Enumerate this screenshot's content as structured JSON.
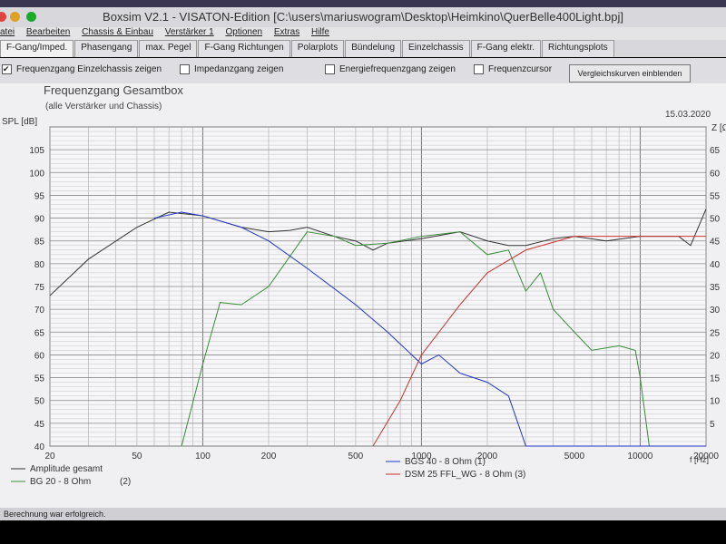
{
  "window": {
    "title": "Boxsim V2.1 - VISATON-Edition [C:\\users\\mariuswogram\\Desktop\\Heimkino\\QuerBelle400Light.bpj]"
  },
  "menu": [
    "atei",
    "Bearbeiten",
    "Chassis & Einbau",
    "Verstärker 1",
    "Optionen",
    "Extras",
    "Hilfe"
  ],
  "tabs": [
    "F-Gang/Imped.",
    "Phasengang",
    "max. Pegel",
    "F-Gang Richtungen",
    "Polarplots",
    "Bündelung",
    "Einzelchassis",
    "F-Gang elektr.",
    "Richtungsplots"
  ],
  "options": [
    {
      "label": "Frequenzgang Einzelchassis zeigen",
      "checked": true
    },
    {
      "label": "Impedanzgang zeigen",
      "checked": false
    },
    {
      "label": "Energiefrequenzgang zeigen",
      "checked": false
    },
    {
      "label": "Frequenzcursor",
      "checked": false
    }
  ],
  "compare_button": "Vergleichskurven einblenden",
  "status": "Berechnung war erfolgreich.",
  "chart_data": {
    "type": "line",
    "title": "Frequenzgang Gesamtbox",
    "subtitle": "(alle Verstärker und Chassis)",
    "date": "15.03.2020",
    "ylabel": "SPL [dB]",
    "y2label": "Z [Ω]",
    "xlabel": "f [Hz]",
    "xlim": [
      20,
      20000
    ],
    "ylim": [
      40,
      110
    ],
    "y2lim": [
      0,
      70
    ],
    "xticks": [
      20,
      50,
      100,
      200,
      500,
      1000,
      2000,
      5000,
      10000,
      20000
    ],
    "yticks": [
      40,
      45,
      50,
      55,
      60,
      65,
      70,
      75,
      80,
      85,
      90,
      95,
      100,
      105
    ],
    "y2ticks": [
      5,
      10,
      15,
      20,
      25,
      30,
      35,
      40,
      45,
      50,
      55,
      60,
      65
    ],
    "series": [
      {
        "name": "Amplitude gesamt",
        "color": "#333333",
        "points": [
          [
            20,
            73
          ],
          [
            30,
            81
          ],
          [
            50,
            88
          ],
          [
            70,
            91.3
          ],
          [
            100,
            90.5
          ],
          [
            150,
            88
          ],
          [
            200,
            87
          ],
          [
            250,
            87.3
          ],
          [
            300,
            88
          ],
          [
            400,
            86
          ],
          [
            500,
            85
          ],
          [
            600,
            83
          ],
          [
            700,
            84.5
          ],
          [
            1000,
            85.5
          ],
          [
            1500,
            87
          ],
          [
            2000,
            85
          ],
          [
            2500,
            84
          ],
          [
            3000,
            84
          ],
          [
            4000,
            85.5
          ],
          [
            5000,
            86
          ],
          [
            7000,
            85
          ],
          [
            10000,
            86
          ],
          [
            15000,
            86
          ],
          [
            17000,
            84
          ],
          [
            20000,
            92
          ]
        ]
      },
      {
        "name": "BG 20 - 8 Ohm",
        "suffix": "(2)",
        "color": "#3a8a3a",
        "points": [
          [
            80,
            40
          ],
          [
            100,
            58
          ],
          [
            120,
            71.5
          ],
          [
            150,
            71
          ],
          [
            200,
            75
          ],
          [
            300,
            87
          ],
          [
            400,
            86
          ],
          [
            500,
            84
          ],
          [
            700,
            84.5
          ],
          [
            1000,
            86
          ],
          [
            1500,
            87
          ],
          [
            2000,
            82
          ],
          [
            2500,
            83
          ],
          [
            3000,
            74
          ],
          [
            3500,
            78
          ],
          [
            4000,
            70
          ],
          [
            5000,
            65
          ],
          [
            6000,
            61
          ],
          [
            8000,
            62
          ],
          [
            9500,
            61
          ],
          [
            10000,
            55
          ],
          [
            11000,
            40
          ]
        ]
      },
      {
        "name": "BGS 40 - 8 Ohm (1)",
        "color": "#2233cc",
        "points": [
          [
            60,
            90
          ],
          [
            80,
            91.3
          ],
          [
            100,
            90.5
          ],
          [
            150,
            88
          ],
          [
            200,
            85
          ],
          [
            300,
            79
          ],
          [
            500,
            71
          ],
          [
            700,
            65
          ],
          [
            1000,
            58
          ],
          [
            1200,
            60
          ],
          [
            1500,
            56
          ],
          [
            2000,
            54
          ],
          [
            2500,
            51
          ],
          [
            3000,
            40
          ],
          [
            20000,
            40
          ]
        ]
      },
      {
        "name": "DSM 25 FFL_WG - 8 Ohm (3)",
        "color": "#cc3333",
        "points": [
          [
            600,
            40
          ],
          [
            800,
            50
          ],
          [
            1000,
            60
          ],
          [
            1500,
            71
          ],
          [
            2000,
            78
          ],
          [
            3000,
            83
          ],
          [
            5000,
            86
          ],
          [
            10000,
            86
          ],
          [
            20000,
            86
          ]
        ]
      }
    ]
  }
}
